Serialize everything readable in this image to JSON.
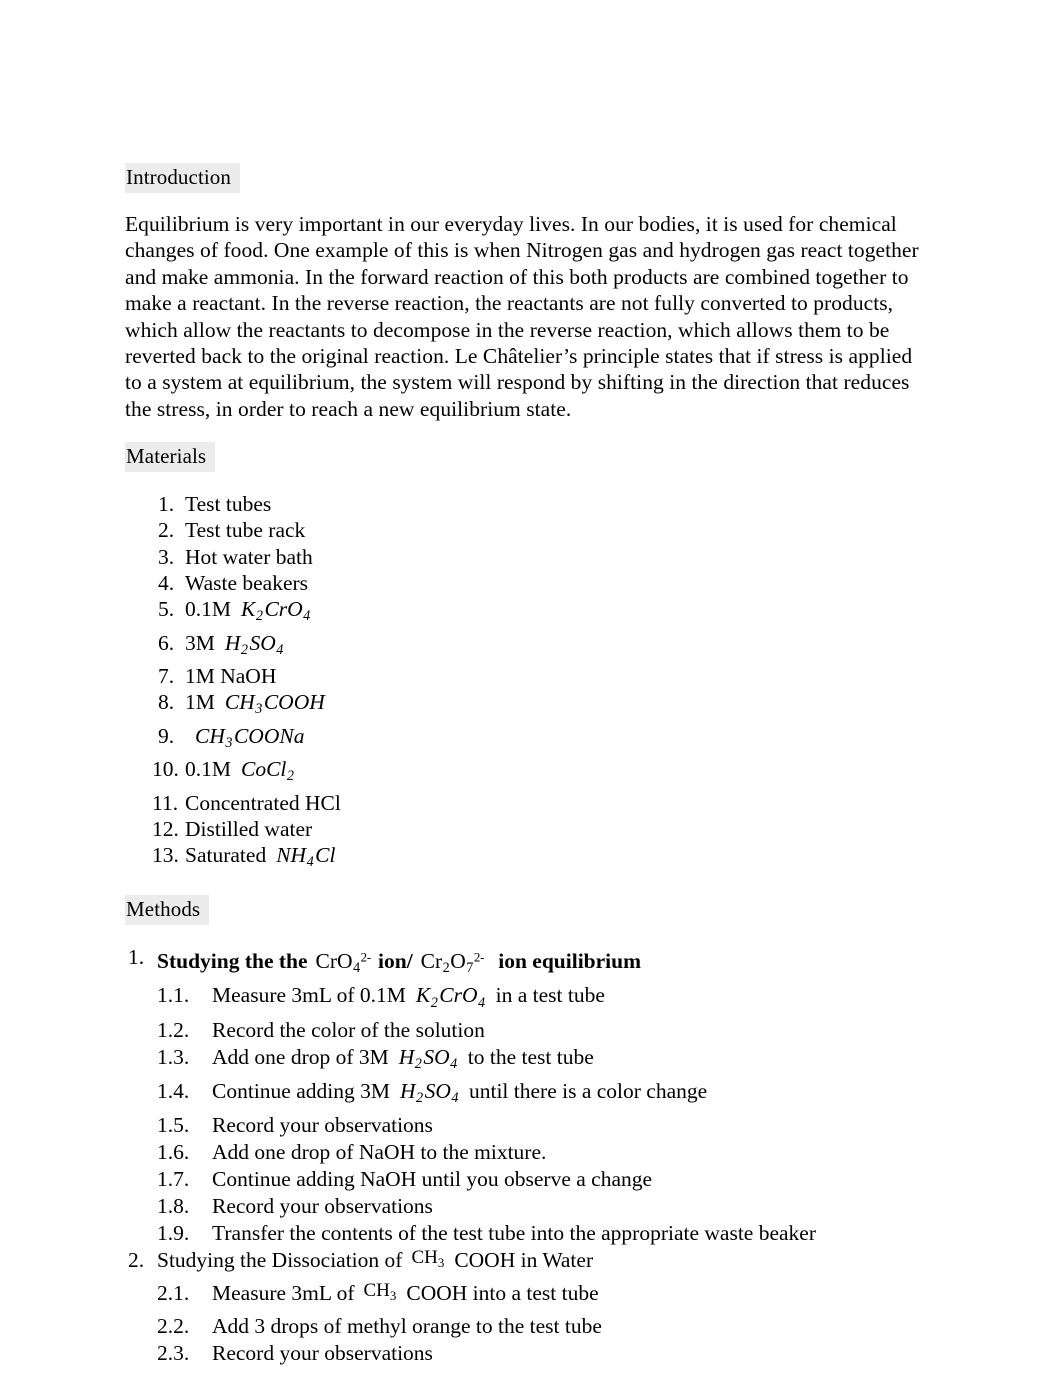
{
  "document": {
    "sections": {
      "introduction": {
        "heading": "Introduction",
        "paragraph": "Equilibrium is very important in our everyday lives. In our bodies, it is used for chemical changes of food. One example of this is when Nitrogen gas and hydrogen gas react together and make ammonia. In the forward reaction of this both products are combined together to make a reactant. In the reverse reaction, the reactants are not fully converted to products, which allow the reactants to decompose in the reverse reaction, which allows them to be reverted back to the original reaction. Le Châtelier’s principle states that if stress is applied to a system at equilibrium, the system will respond by shifting in the direction that reduces the stress, in order to reach a new equilibrium state."
      },
      "materials": {
        "heading": "Materials",
        "items": [
          {
            "num": "1.",
            "text": "Test tubes"
          },
          {
            "num": "2.",
            "text": "Test tube rack"
          },
          {
            "num": "3.",
            "text": "Hot water bath"
          },
          {
            "num": "4.",
            "text": "Waste beakers"
          },
          {
            "num": "5.",
            "text": "0.1M",
            "formula": "K2CrO4"
          },
          {
            "num": "6.",
            "text": "3M",
            "formula": "H2SO4"
          },
          {
            "num": "7.",
            "text": "1M NaOH"
          },
          {
            "num": "8.",
            "text": "1M",
            "formula": "CH3COOH"
          },
          {
            "num": "9.",
            "text": "",
            "formula": "CH3COONa"
          },
          {
            "num": "10.",
            "text": "0.1M",
            "formula": "CoCl2"
          },
          {
            "num": "11.",
            "text": "Concentrated HCl"
          },
          {
            "num": "12.",
            "text": "Distilled water"
          },
          {
            "num": "13.",
            "text": "Saturated",
            "formula": "NH4Cl"
          }
        ]
      },
      "methods": {
        "heading": "Methods",
        "items": [
          {
            "num": "1.",
            "bold": true,
            "title_part1": "Studying the the",
            "formula1": "CrO4 2-",
            "title_part2": "ion/",
            "formula2": "Cr2O7 2-",
            "title_part3": "ion equilibrium",
            "substeps": [
              {
                "num": "1.1.",
                "text_before": "Measure 3mL of 0.1M",
                "formula": "K2CrO4",
                "text_after": "in a test tube"
              },
              {
                "num": "1.2.",
                "text_before": "Record the color of the solution",
                "formula": "",
                "text_after": ""
              },
              {
                "num": "1.3.",
                "text_before": "Add one drop of 3M",
                "formula": "H2SO4",
                "text_after": "to the test tube"
              },
              {
                "num": "1.4.",
                "text_before": "Continue adding 3M",
                "formula": "H2SO4",
                "text_after": "until there is a color change"
              },
              {
                "num": "1.5.",
                "text_before": "Record your observations",
                "formula": "",
                "text_after": ""
              },
              {
                "num": "1.6.",
                "text_before": "Add one drop of NaOH to the mixture.",
                "formula": "",
                "text_after": ""
              },
              {
                "num": "1.7.",
                "text_before": "Continue adding NaOH until you observe a change",
                "formula": "",
                "text_after": ""
              },
              {
                "num": "1.8.",
                "text_before": "Record your observations",
                "formula": "",
                "text_after": ""
              },
              {
                "num": "1.9.",
                "text_before": "Transfer the contents of the test tube into the appropriate waste beaker",
                "formula": "",
                "text_after": ""
              }
            ]
          },
          {
            "num": "2.",
            "bold": false,
            "title_part1": "Studying the Dissociation of",
            "formula1": "CH3",
            "title_part2": "COOH in Water",
            "formula2": "",
            "title_part3": "",
            "substeps": [
              {
                "num": "2.1.",
                "text_before": "Measure 3mL of",
                "formula": "CH3",
                "text_after": "COOH into a test tube"
              },
              {
                "num": "2.2.",
                "text_before": "Add 3 drops of methyl orange to the test tube",
                "formula": "",
                "text_after": ""
              },
              {
                "num": "2.3.",
                "text_before": "Record your observations",
                "formula": "",
                "text_after": ""
              }
            ]
          }
        ]
      }
    },
    "colors": {
      "text": "#000000",
      "page_background": "#ffffff",
      "heading_highlight": "#ececec"
    }
  }
}
